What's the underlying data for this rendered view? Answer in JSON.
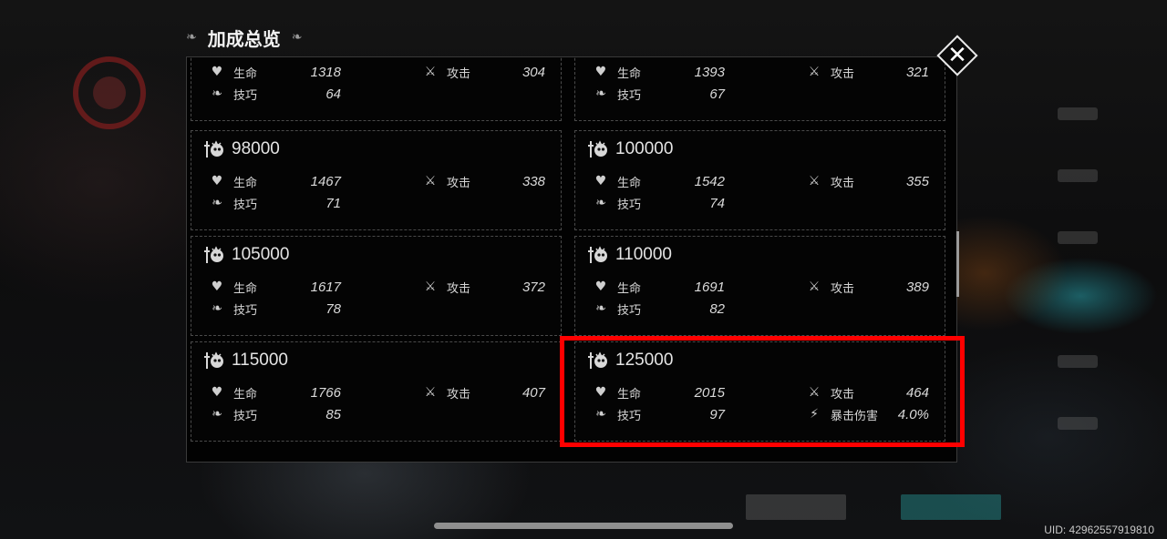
{
  "title": "加成总览",
  "uid": "UID: 42962557919810",
  "close_icon": "close-icon",
  "partial_cards": [
    {
      "stats": [
        {
          "icon": "heart-icon",
          "label": "生命",
          "value": "1318"
        },
        {
          "icon": "crossed-swords-icon",
          "label": "攻击",
          "value": "304"
        },
        {
          "icon": "technique-icon",
          "label": "技巧",
          "value": "64"
        }
      ]
    },
    {
      "stats": [
        {
          "icon": "heart-icon",
          "label": "生命",
          "value": "1393"
        },
        {
          "icon": "crossed-swords-icon",
          "label": "攻击",
          "value": "321"
        },
        {
          "icon": "technique-icon",
          "label": "技巧",
          "value": "67"
        }
      ]
    }
  ],
  "cards": [
    {
      "threshold": "98000",
      "stats": [
        {
          "icon": "heart-icon",
          "label": "生命",
          "value": "1467"
        },
        {
          "icon": "crossed-swords-icon",
          "label": "攻击",
          "value": "338"
        },
        {
          "icon": "technique-icon",
          "label": "技巧",
          "value": "71"
        }
      ]
    },
    {
      "threshold": "100000",
      "stats": [
        {
          "icon": "heart-icon",
          "label": "生命",
          "value": "1542"
        },
        {
          "icon": "crossed-swords-icon",
          "label": "攻击",
          "value": "355"
        },
        {
          "icon": "technique-icon",
          "label": "技巧",
          "value": "74"
        }
      ]
    },
    {
      "threshold": "105000",
      "stats": [
        {
          "icon": "heart-icon",
          "label": "生命",
          "value": "1617"
        },
        {
          "icon": "crossed-swords-icon",
          "label": "攻击",
          "value": "372"
        },
        {
          "icon": "technique-icon",
          "label": "技巧",
          "value": "78"
        }
      ]
    },
    {
      "threshold": "110000",
      "stats": [
        {
          "icon": "heart-icon",
          "label": "生命",
          "value": "1691"
        },
        {
          "icon": "crossed-swords-icon",
          "label": "攻击",
          "value": "389"
        },
        {
          "icon": "technique-icon",
          "label": "技巧",
          "value": "82"
        }
      ]
    },
    {
      "threshold": "115000",
      "stats": [
        {
          "icon": "heart-icon",
          "label": "生命",
          "value": "1766"
        },
        {
          "icon": "crossed-swords-icon",
          "label": "攻击",
          "value": "407"
        },
        {
          "icon": "technique-icon",
          "label": "技巧",
          "value": "85"
        }
      ]
    },
    {
      "threshold": "125000",
      "stats": [
        {
          "icon": "heart-icon",
          "label": "生命",
          "value": "2015"
        },
        {
          "icon": "crossed-swords-icon",
          "label": "攻击",
          "value": "464"
        },
        {
          "icon": "technique-icon",
          "label": "技巧",
          "value": "97"
        },
        {
          "icon": "crit-damage-icon",
          "label": "暴击伤害",
          "value": "4.0%"
        }
      ]
    }
  ],
  "highlight_color": "#ff0000"
}
